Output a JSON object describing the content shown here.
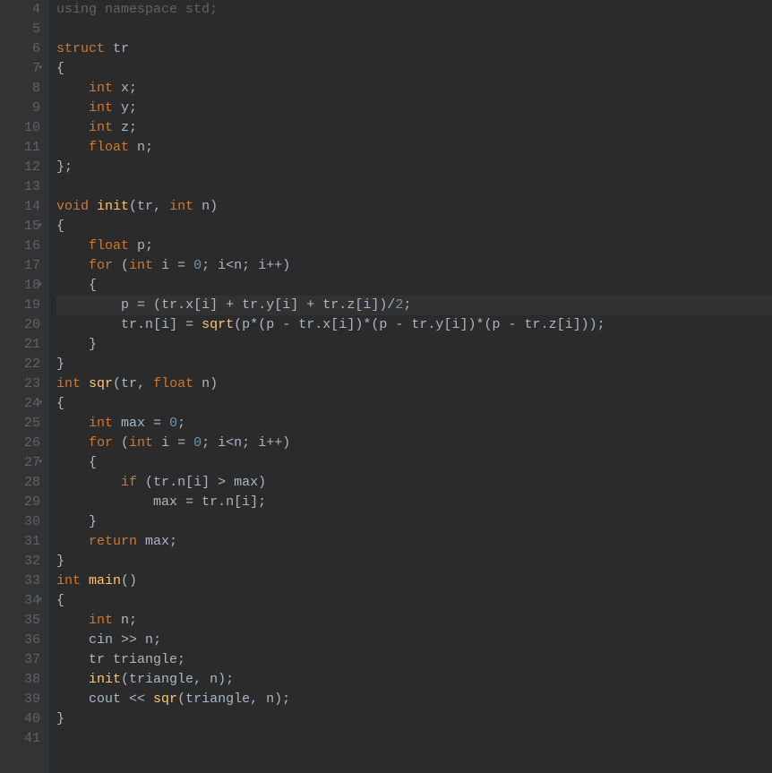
{
  "editor": {
    "highlighted_line": 19,
    "lines": [
      {
        "num": 4,
        "fold": false,
        "tokens": [
          [
            "kw",
            "using "
          ],
          [
            "kw",
            "namespace "
          ],
          [
            "ident",
            "std"
          ],
          [
            "punct",
            ";"
          ]
        ],
        "faded": true
      },
      {
        "num": 5,
        "fold": false,
        "tokens": []
      },
      {
        "num": 6,
        "fold": false,
        "tokens": [
          [
            "kw",
            "struct "
          ],
          [
            "ident",
            "tr"
          ]
        ]
      },
      {
        "num": 7,
        "fold": true,
        "tokens": [
          [
            "punct",
            "{"
          ]
        ]
      },
      {
        "num": 8,
        "fold": false,
        "tokens": [
          [
            "ident",
            "    "
          ],
          [
            "kw",
            "int "
          ],
          [
            "ident",
            "x"
          ],
          [
            "punct",
            ";"
          ]
        ]
      },
      {
        "num": 9,
        "fold": false,
        "tokens": [
          [
            "ident",
            "    "
          ],
          [
            "kw",
            "int "
          ],
          [
            "ident",
            "y"
          ],
          [
            "punct",
            ";"
          ]
        ]
      },
      {
        "num": 10,
        "fold": false,
        "tokens": [
          [
            "ident",
            "    "
          ],
          [
            "kw",
            "int "
          ],
          [
            "ident",
            "z"
          ],
          [
            "punct",
            ";"
          ]
        ]
      },
      {
        "num": 11,
        "fold": false,
        "tokens": [
          [
            "ident",
            "    "
          ],
          [
            "kw",
            "float "
          ],
          [
            "ident",
            "n"
          ],
          [
            "punct",
            ";"
          ]
        ]
      },
      {
        "num": 12,
        "fold": false,
        "tokens": [
          [
            "punct",
            "};"
          ]
        ]
      },
      {
        "num": 13,
        "fold": false,
        "tokens": []
      },
      {
        "num": 14,
        "fold": false,
        "tokens": [
          [
            "kw",
            "void "
          ],
          [
            "func",
            "init"
          ],
          [
            "punct",
            "("
          ],
          [
            "ident",
            "tr"
          ],
          [
            "punct",
            ", "
          ],
          [
            "kw",
            "int "
          ],
          [
            "ident",
            "n"
          ],
          [
            "punct",
            ")"
          ]
        ]
      },
      {
        "num": 15,
        "fold": true,
        "tokens": [
          [
            "punct",
            "{"
          ]
        ]
      },
      {
        "num": 16,
        "fold": false,
        "tokens": [
          [
            "ident",
            "    "
          ],
          [
            "kw",
            "float "
          ],
          [
            "ident",
            "p"
          ],
          [
            "punct",
            ";"
          ]
        ]
      },
      {
        "num": 17,
        "fold": false,
        "tokens": [
          [
            "ident",
            "    "
          ],
          [
            "kw",
            "for "
          ],
          [
            "punct",
            "("
          ],
          [
            "kw",
            "int "
          ],
          [
            "ident",
            "i "
          ],
          [
            "op",
            "= "
          ],
          [
            "num",
            "0"
          ],
          [
            "punct",
            "; "
          ],
          [
            "ident",
            "i"
          ],
          [
            "op",
            "<"
          ],
          [
            "ident",
            "n"
          ],
          [
            "punct",
            "; "
          ],
          [
            "ident",
            "i"
          ],
          [
            "op",
            "++"
          ],
          [
            "punct",
            ")"
          ]
        ]
      },
      {
        "num": 18,
        "fold": true,
        "tokens": [
          [
            "ident",
            "    "
          ],
          [
            "punct",
            "{"
          ]
        ]
      },
      {
        "num": 19,
        "fold": false,
        "tokens": [
          [
            "ident",
            "        "
          ],
          [
            "ident",
            "p "
          ],
          [
            "op",
            "= "
          ],
          [
            "punct",
            "("
          ],
          [
            "ident",
            "tr"
          ],
          [
            "punct",
            "."
          ],
          [
            "ident",
            "x"
          ],
          [
            "punct",
            "["
          ],
          [
            "ident",
            "i"
          ],
          [
            "punct",
            "] "
          ],
          [
            "op",
            "+ "
          ],
          [
            "ident",
            "tr"
          ],
          [
            "punct",
            "."
          ],
          [
            "ident",
            "y"
          ],
          [
            "punct",
            "["
          ],
          [
            "ident",
            "i"
          ],
          [
            "punct",
            "] "
          ],
          [
            "op",
            "+ "
          ],
          [
            "ident",
            "tr"
          ],
          [
            "punct",
            "."
          ],
          [
            "ident",
            "z"
          ],
          [
            "punct",
            "["
          ],
          [
            "ident",
            "i"
          ],
          [
            "punct",
            "])"
          ],
          [
            "op",
            "/"
          ],
          [
            "num",
            "2"
          ],
          [
            "punct",
            ";"
          ]
        ]
      },
      {
        "num": 20,
        "fold": false,
        "tokens": [
          [
            "ident",
            "        "
          ],
          [
            "ident",
            "tr"
          ],
          [
            "punct",
            "."
          ],
          [
            "ident",
            "n"
          ],
          [
            "punct",
            "["
          ],
          [
            "ident",
            "i"
          ],
          [
            "punct",
            "] "
          ],
          [
            "op",
            "= "
          ],
          [
            "func",
            "sqrt"
          ],
          [
            "punct",
            "("
          ],
          [
            "ident",
            "p"
          ],
          [
            "op",
            "*"
          ],
          [
            "punct",
            "("
          ],
          [
            "ident",
            "p "
          ],
          [
            "op",
            "- "
          ],
          [
            "ident",
            "tr"
          ],
          [
            "punct",
            "."
          ],
          [
            "ident",
            "x"
          ],
          [
            "punct",
            "["
          ],
          [
            "ident",
            "i"
          ],
          [
            "punct",
            "])"
          ],
          [
            "op",
            "*"
          ],
          [
            "punct",
            "("
          ],
          [
            "ident",
            "p "
          ],
          [
            "op",
            "- "
          ],
          [
            "ident",
            "tr"
          ],
          [
            "punct",
            "."
          ],
          [
            "ident",
            "y"
          ],
          [
            "punct",
            "["
          ],
          [
            "ident",
            "i"
          ],
          [
            "punct",
            "])"
          ],
          [
            "op",
            "*"
          ],
          [
            "punct",
            "("
          ],
          [
            "ident",
            "p "
          ],
          [
            "op",
            "- "
          ],
          [
            "ident",
            "tr"
          ],
          [
            "punct",
            "."
          ],
          [
            "ident",
            "z"
          ],
          [
            "punct",
            "["
          ],
          [
            "ident",
            "i"
          ],
          [
            "punct",
            "]));"
          ]
        ]
      },
      {
        "num": 21,
        "fold": false,
        "tokens": [
          [
            "ident",
            "    "
          ],
          [
            "punct",
            "}"
          ]
        ]
      },
      {
        "num": 22,
        "fold": false,
        "tokens": [
          [
            "punct",
            "}"
          ]
        ]
      },
      {
        "num": 23,
        "fold": false,
        "tokens": [
          [
            "kw",
            "int "
          ],
          [
            "func",
            "sqr"
          ],
          [
            "punct",
            "("
          ],
          [
            "ident",
            "tr"
          ],
          [
            "punct",
            ", "
          ],
          [
            "kw",
            "float "
          ],
          [
            "ident",
            "n"
          ],
          [
            "punct",
            ")"
          ]
        ]
      },
      {
        "num": 24,
        "fold": true,
        "tokens": [
          [
            "punct",
            "{"
          ]
        ]
      },
      {
        "num": 25,
        "fold": false,
        "tokens": [
          [
            "ident",
            "    "
          ],
          [
            "kw",
            "int "
          ],
          [
            "ident",
            "max "
          ],
          [
            "op",
            "= "
          ],
          [
            "num",
            "0"
          ],
          [
            "punct",
            ";"
          ]
        ]
      },
      {
        "num": 26,
        "fold": false,
        "tokens": [
          [
            "ident",
            "    "
          ],
          [
            "kw",
            "for "
          ],
          [
            "punct",
            "("
          ],
          [
            "kw",
            "int "
          ],
          [
            "ident",
            "i "
          ],
          [
            "op",
            "= "
          ],
          [
            "num",
            "0"
          ],
          [
            "punct",
            "; "
          ],
          [
            "ident",
            "i"
          ],
          [
            "op",
            "<"
          ],
          [
            "ident",
            "n"
          ],
          [
            "punct",
            "; "
          ],
          [
            "ident",
            "i"
          ],
          [
            "op",
            "++"
          ],
          [
            "punct",
            ")"
          ]
        ]
      },
      {
        "num": 27,
        "fold": true,
        "tokens": [
          [
            "ident",
            "    "
          ],
          [
            "punct",
            "{"
          ]
        ]
      },
      {
        "num": 28,
        "fold": false,
        "tokens": [
          [
            "ident",
            "        "
          ],
          [
            "kw",
            "if "
          ],
          [
            "punct",
            "("
          ],
          [
            "ident",
            "tr"
          ],
          [
            "punct",
            "."
          ],
          [
            "ident",
            "n"
          ],
          [
            "punct",
            "["
          ],
          [
            "ident",
            "i"
          ],
          [
            "punct",
            "] "
          ],
          [
            "op",
            "> "
          ],
          [
            "ident",
            "max"
          ],
          [
            "punct",
            ")"
          ]
        ]
      },
      {
        "num": 29,
        "fold": false,
        "tokens": [
          [
            "ident",
            "            "
          ],
          [
            "ident",
            "max "
          ],
          [
            "op",
            "= "
          ],
          [
            "ident",
            "tr"
          ],
          [
            "punct",
            "."
          ],
          [
            "ident",
            "n"
          ],
          [
            "punct",
            "["
          ],
          [
            "ident",
            "i"
          ],
          [
            "punct",
            "];"
          ]
        ]
      },
      {
        "num": 30,
        "fold": false,
        "tokens": [
          [
            "ident",
            "    "
          ],
          [
            "punct",
            "}"
          ]
        ]
      },
      {
        "num": 31,
        "fold": false,
        "tokens": [
          [
            "ident",
            "    "
          ],
          [
            "kw",
            "return "
          ],
          [
            "ident",
            "max"
          ],
          [
            "punct",
            ";"
          ]
        ]
      },
      {
        "num": 32,
        "fold": false,
        "tokens": [
          [
            "punct",
            "}"
          ]
        ]
      },
      {
        "num": 33,
        "fold": false,
        "tokens": [
          [
            "kw",
            "int "
          ],
          [
            "func",
            "main"
          ],
          [
            "punct",
            "()"
          ]
        ]
      },
      {
        "num": 34,
        "fold": true,
        "tokens": [
          [
            "punct",
            "{"
          ]
        ]
      },
      {
        "num": 35,
        "fold": false,
        "tokens": [
          [
            "ident",
            "    "
          ],
          [
            "kw",
            "int "
          ],
          [
            "ident",
            "n"
          ],
          [
            "punct",
            ";"
          ]
        ]
      },
      {
        "num": 36,
        "fold": false,
        "tokens": [
          [
            "ident",
            "    "
          ],
          [
            "ident",
            "cin "
          ],
          [
            "op",
            ">> "
          ],
          [
            "ident",
            "n"
          ],
          [
            "punct",
            ";"
          ]
        ]
      },
      {
        "num": 37,
        "fold": false,
        "tokens": [
          [
            "ident",
            "    "
          ],
          [
            "ident",
            "tr triangle"
          ],
          [
            "punct",
            ";"
          ]
        ]
      },
      {
        "num": 38,
        "fold": false,
        "tokens": [
          [
            "ident",
            "    "
          ],
          [
            "func",
            "init"
          ],
          [
            "punct",
            "("
          ],
          [
            "ident",
            "triangle"
          ],
          [
            "punct",
            ", "
          ],
          [
            "ident",
            "n"
          ],
          [
            "punct",
            ");"
          ]
        ]
      },
      {
        "num": 39,
        "fold": false,
        "tokens": [
          [
            "ident",
            "    "
          ],
          [
            "ident",
            "cout "
          ],
          [
            "op",
            "<< "
          ],
          [
            "func",
            "sqr"
          ],
          [
            "punct",
            "("
          ],
          [
            "ident",
            "triangle"
          ],
          [
            "punct",
            ", "
          ],
          [
            "ident",
            "n"
          ],
          [
            "punct",
            ");"
          ]
        ]
      },
      {
        "num": 40,
        "fold": false,
        "tokens": [
          [
            "punct",
            "}"
          ]
        ]
      },
      {
        "num": 41,
        "fold": false,
        "tokens": []
      }
    ]
  }
}
